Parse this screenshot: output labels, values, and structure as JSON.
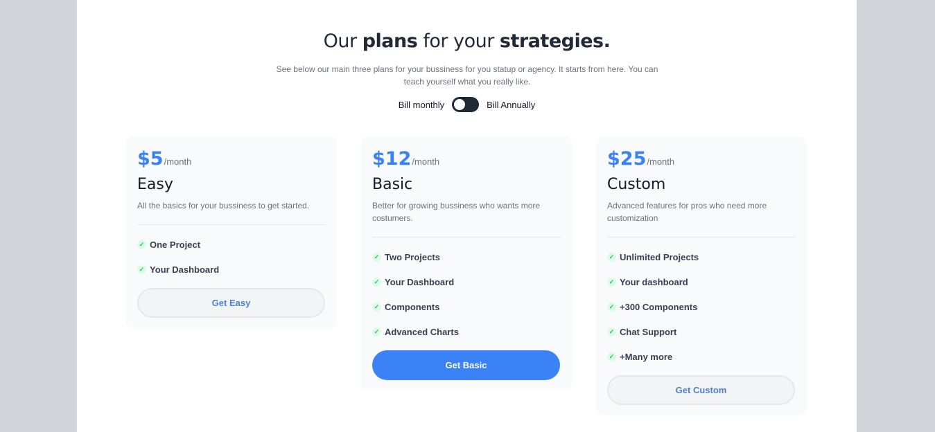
{
  "header": {
    "title_1": "Our ",
    "title_2": "plans",
    "title_3": " for your ",
    "title_4": "strategies.",
    "subtitle": "See below our main three plans for your bussiness for you statup or agency. It starts from here. You can teach yourself what you really like."
  },
  "billing": {
    "monthly_label": "Bill monthly",
    "annually_label": "Bill Annually",
    "annual_selected": false
  },
  "plans": [
    {
      "amount": "$5",
      "period": "/month",
      "name": "Easy",
      "description": "All the basics for your bussiness to get started.",
      "features": [
        "One Project",
        "Your Dashboard"
      ],
      "button": "Get Easy"
    },
    {
      "amount": "$12",
      "period": "/month",
      "name": "Basic",
      "description": "Better for growing bussiness who wants more costumers.",
      "features": [
        "Two Projects",
        "Your Dashboard",
        "Components",
        "Advanced Charts"
      ],
      "button": "Get Basic"
    },
    {
      "amount": "$25",
      "period": "/month",
      "name": "Custom",
      "description": "Advanced features for pros who need more customization",
      "features": [
        "Unlimited Projects",
        "Your dashboard",
        "+300 Components",
        "Chat Support",
        "+Many more"
      ],
      "button": "Get Custom"
    }
  ],
  "icons": {
    "feature": "check-icon"
  },
  "colors": {
    "accent": "#3b82f6",
    "toggle": "#1f2937",
    "check": "#22c55e"
  }
}
